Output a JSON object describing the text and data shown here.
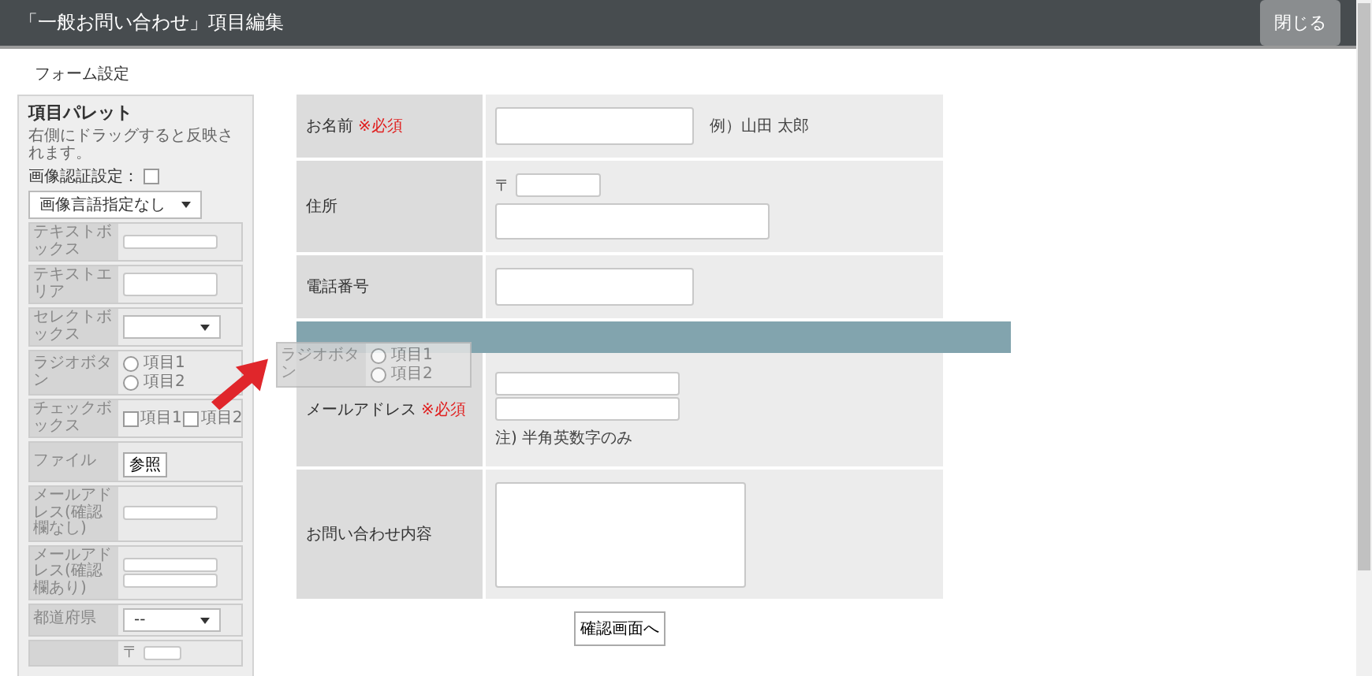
{
  "header": {
    "title": "「一般お問い合わせ」項目編集",
    "close_button": "閉じる"
  },
  "section_title": "フォーム設定",
  "palette": {
    "title": "項目パレット",
    "hint": "右側にドラッグすると反映されます。",
    "captcha": {
      "label": "画像認証設定：",
      "checked": false
    },
    "language_select": "画像言語指定なし",
    "items": [
      {
        "kind": "text",
        "label": "テキストボックス"
      },
      {
        "kind": "textarea",
        "label": "テキストエリア"
      },
      {
        "kind": "select",
        "label": "セレクトボックス"
      },
      {
        "kind": "radio",
        "label": "ラジオボタン",
        "options": [
          "項目1",
          "項目2"
        ]
      },
      {
        "kind": "checkbox",
        "label": "チェックボックス",
        "options": [
          {
            "label": "項目1",
            "checked": false
          },
          {
            "label": "項目2",
            "checked": false
          }
        ]
      },
      {
        "kind": "file",
        "label": "ファイル",
        "button": "参照"
      },
      {
        "kind": "text",
        "label": "メールアドレス(確認欄なし)"
      },
      {
        "kind": "double",
        "label": "メールアドレス(確認欄あり)"
      },
      {
        "kind": "select",
        "label": "都道府県",
        "value": "--"
      },
      {
        "kind": "zip",
        "symbol": "〒"
      }
    ]
  },
  "dragged_item": {
    "label": "ラジオボタン",
    "options": [
      "項目1",
      "項目2"
    ]
  },
  "form": {
    "rows": [
      {
        "kind": "name",
        "label": "お名前",
        "required": "※必須",
        "note": "例）山田 太郎"
      },
      {
        "kind": "address",
        "label": "住所",
        "symbol": "〒"
      },
      {
        "kind": "phone",
        "label": "電話番号"
      },
      {
        "kind": "drop"
      },
      {
        "kind": "email",
        "label": "メールアドレス",
        "required": "※必須",
        "note": "注) 半角英数字のみ"
      },
      {
        "kind": "textarea",
        "label": "お問い合わせ内容"
      }
    ],
    "submit": "確認画面へ"
  }
}
